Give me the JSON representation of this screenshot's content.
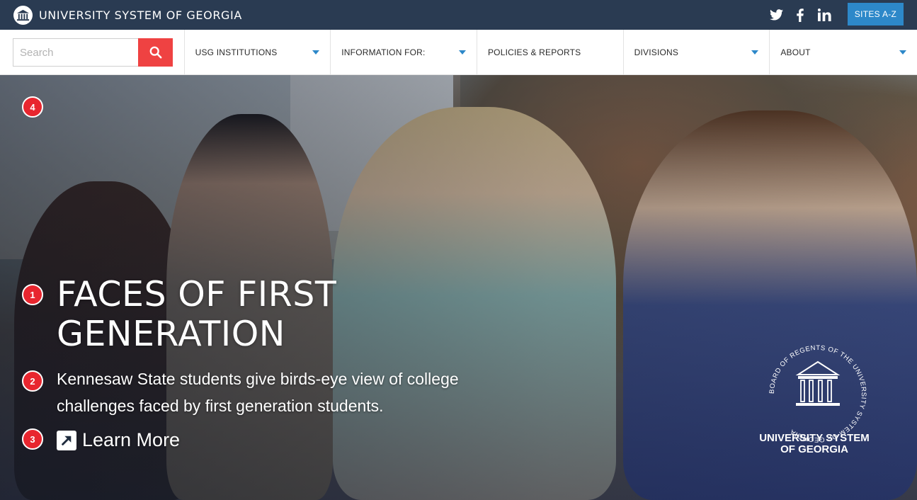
{
  "header": {
    "site_title": "UNIVERSITY SYSTEM OF GEORGIA",
    "social": [
      "twitter-icon",
      "facebook-icon",
      "linkedin-icon"
    ],
    "sites_button": "SITES A-Z"
  },
  "search": {
    "placeholder": "Search",
    "value": ""
  },
  "nav": {
    "items": [
      {
        "label": "USG INSTITUTIONS",
        "dropdown": true
      },
      {
        "label": "INFORMATION FOR:",
        "dropdown": true
      },
      {
        "label": "POLICIES & REPORTS",
        "dropdown": false
      },
      {
        "label": "DIVISIONS",
        "dropdown": true
      },
      {
        "label": "ABOUT",
        "dropdown": true
      }
    ]
  },
  "hero": {
    "title_line1": "FACES OF FIRST",
    "title_line2": "GENERATION",
    "subtitle_line1": "Kennesaw State students give birds-eye view of college",
    "subtitle_line2": "challenges faced by first generation students.",
    "cta": "Learn More",
    "markers": [
      "1",
      "2",
      "3",
      "4"
    ],
    "seal_name_line1": "UNIVERSITY SYSTEM",
    "seal_name_line2": "OF GEORGIA",
    "seal_ring_text": "BOARD OF REGENTS OF THE UNIVERSITY SYSTEM OF GEORGIA"
  },
  "colors": {
    "topbar": "#2a3b52",
    "accent_blue": "#2d88c9",
    "search_red": "#ef4242",
    "marker_red": "#e8262f"
  }
}
